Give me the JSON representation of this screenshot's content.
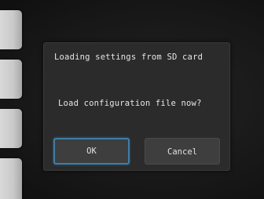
{
  "dialog": {
    "title": "Loading settings from SD card",
    "message": "Load configuration file now?",
    "ok_label": "OK",
    "cancel_label": "Cancel"
  }
}
